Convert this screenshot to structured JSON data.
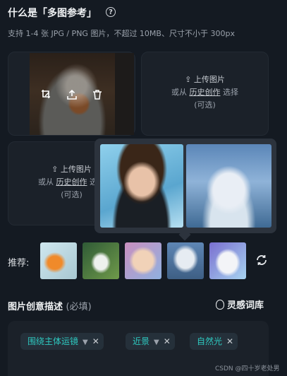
{
  "header": {
    "title": "什么是「多图参考」",
    "subtitle": "支持 1-4 张 JPG / PNG 图片，不超过 10MB、尺寸不小于 300px"
  },
  "upload": {
    "upload_label": "上传图片",
    "or_from": "或从",
    "history_link": "历史创作",
    "select": "选择",
    "optional": "(可选)"
  },
  "recommend": {
    "label": "推荐:"
  },
  "description": {
    "title": "图片创意描述",
    "required": "(必填)",
    "inspiration_label": "灵感词库",
    "tags": [
      "围绕主体运镜",
      "近景",
      "自然光"
    ]
  },
  "watermark": "CSDN @四十岁老处男",
  "colors": {
    "accent": "#2ec9c0",
    "background": "#141a22",
    "card": "#1b2129",
    "popover": "#2c333d"
  },
  "icons": [
    "help-icon",
    "crop-icon",
    "upload-icon",
    "trash-icon",
    "refresh-icon",
    "lightbulb-icon",
    "chevron-down-icon",
    "close-icon"
  ]
}
